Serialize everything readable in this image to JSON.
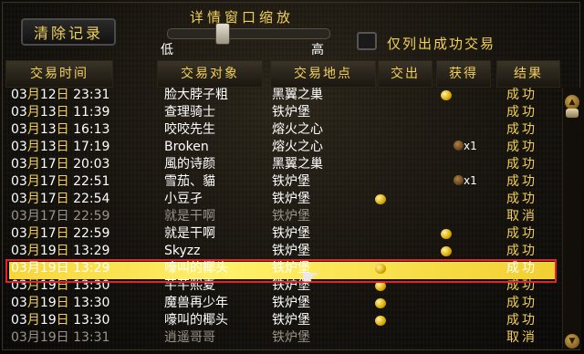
{
  "toolbar": {
    "clear_label": "清除记录",
    "slider_title": "详情窗口缩放",
    "slider_low": "低",
    "slider_high": "高",
    "slider_level": 0.32,
    "filter_label": "仅列出成功交易"
  },
  "columns": [
    "交易时间",
    "交易对象",
    "交易地点",
    "交出",
    "获得",
    "结果"
  ],
  "rows": [
    {
      "month": "03",
      "day": "12",
      "time": "23:31",
      "player": "脸大脖子粗",
      "place": "黑翼之巢",
      "give": false,
      "get": "coin",
      "result": "成功",
      "dim": false
    },
    {
      "month": "03",
      "day": "13",
      "time": "11:39",
      "player": "查理骑士",
      "place": "铁炉堡",
      "give": false,
      "get": "",
      "result": "成功",
      "dim": false
    },
    {
      "month": "03",
      "day": "13",
      "time": "16:13",
      "player": "咬咬先生",
      "place": "熔火之心",
      "give": false,
      "get": "",
      "result": "成功",
      "dim": false
    },
    {
      "month": "03",
      "day": "13",
      "time": "17:19",
      "player": "Broken",
      "place": "熔火之心",
      "give": false,
      "get": "bag",
      "get_count": "x1",
      "result": "成功",
      "dim": false
    },
    {
      "month": "03",
      "day": "17",
      "time": "20:03",
      "player": "風的诗颜",
      "place": "黑翼之巢",
      "give": false,
      "get": "",
      "result": "成功",
      "dim": false
    },
    {
      "month": "03",
      "day": "17",
      "time": "22:51",
      "player": "雪茄、貓",
      "place": "铁炉堡",
      "give": false,
      "get": "bag",
      "get_count": "x1",
      "result": "成功",
      "dim": false
    },
    {
      "month": "03",
      "day": "17",
      "time": "22:54",
      "player": "小豆孑",
      "place": "铁炉堡",
      "give": true,
      "get": "",
      "result": "成功",
      "dim": false
    },
    {
      "month": "03",
      "day": "17",
      "time": "22:59",
      "player": "就是干啊",
      "place": "铁炉堡",
      "give": false,
      "get": "",
      "result": "取消",
      "dim": true
    },
    {
      "month": "03",
      "day": "17",
      "time": "22:59",
      "player": "就是干啊",
      "place": "铁炉堡",
      "give": false,
      "get": "coin",
      "result": "成功",
      "dim": false
    },
    {
      "month": "03",
      "day": "19",
      "time": "13:29",
      "player": "Skyzz",
      "place": "铁炉堡",
      "give": false,
      "get": "coin",
      "result": "成功",
      "dim": false
    },
    {
      "month": "03",
      "day": "19",
      "time": "13:29",
      "player": "嚎叫的椰头",
      "place": "铁炉堡",
      "give": true,
      "get": "",
      "result": "成功",
      "dim": false,
      "highlight": true
    },
    {
      "month": "03",
      "day": "19",
      "time": "13:30",
      "player": "芊芊熙夏",
      "place": "铁炉堡",
      "give": true,
      "get": "",
      "result": "成功",
      "dim": false
    },
    {
      "month": "03",
      "day": "19",
      "time": "13:30",
      "player": "魔兽再少年",
      "place": "铁炉堡",
      "give": true,
      "get": "",
      "result": "成功",
      "dim": false
    },
    {
      "month": "03",
      "day": "19",
      "time": "13:30",
      "player": "嚎叫的椰头",
      "place": "铁炉堡",
      "give": true,
      "get": "",
      "result": "成功",
      "dim": false
    },
    {
      "month": "03",
      "day": "19",
      "time": "13:31",
      "player": "逍遥哥哥",
      "place": "铁炉堡",
      "give": false,
      "get": "",
      "result": "取消",
      "dim": true
    }
  ],
  "labels": {
    "month_suffix": "月",
    "day_suffix": "日"
  },
  "colors": {
    "accent": "#f2d05a",
    "highlight_border": "#e0242b",
    "highlight_bar": "#f6d63a"
  }
}
